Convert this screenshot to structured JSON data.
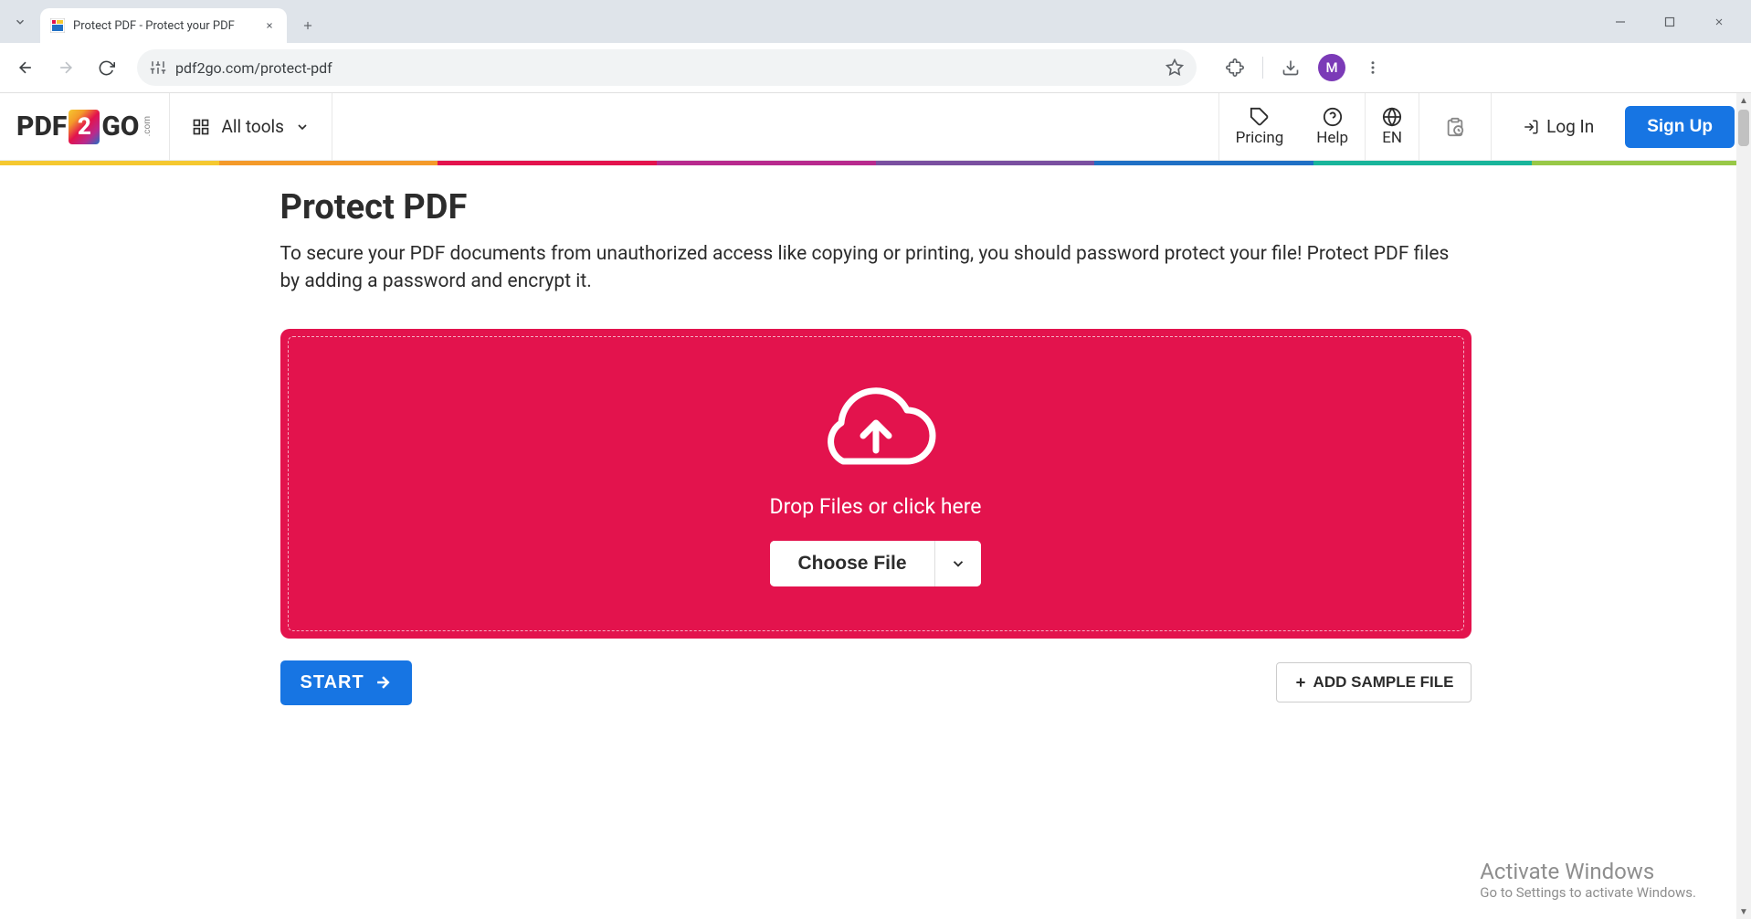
{
  "browser": {
    "tab_title": "Protect PDF - Protect your PDF",
    "url": "pdf2go.com/protect-pdf",
    "profile_letter": "M"
  },
  "header": {
    "logo_text_1": "PDF",
    "logo_text_2": "2",
    "logo_text_3": "GO",
    "logo_suffix": ".com",
    "all_tools_label": "All tools",
    "pricing_label": "Pricing",
    "help_label": "Help",
    "language_label": "EN",
    "login_label": "Log In",
    "signup_label": "Sign Up"
  },
  "rainbow_colors": [
    "#f5c830",
    "#f49a2a",
    "#e3134d",
    "#b82a8e",
    "#7a4fa0",
    "#2070c5",
    "#19b59b",
    "#98c847"
  ],
  "page": {
    "title": "Protect PDF",
    "description": "To secure your PDF documents from unauthorized access like copying or printing, you should password protect your file! Protect PDF files by adding a password and encrypt it.",
    "drop_text": "Drop Files or click here",
    "choose_file_label": "Choose File",
    "start_label": "START",
    "add_sample_label": "ADD SAMPLE FILE"
  },
  "watermark": {
    "title": "Activate Windows",
    "subtitle": "Go to Settings to activate Windows."
  }
}
